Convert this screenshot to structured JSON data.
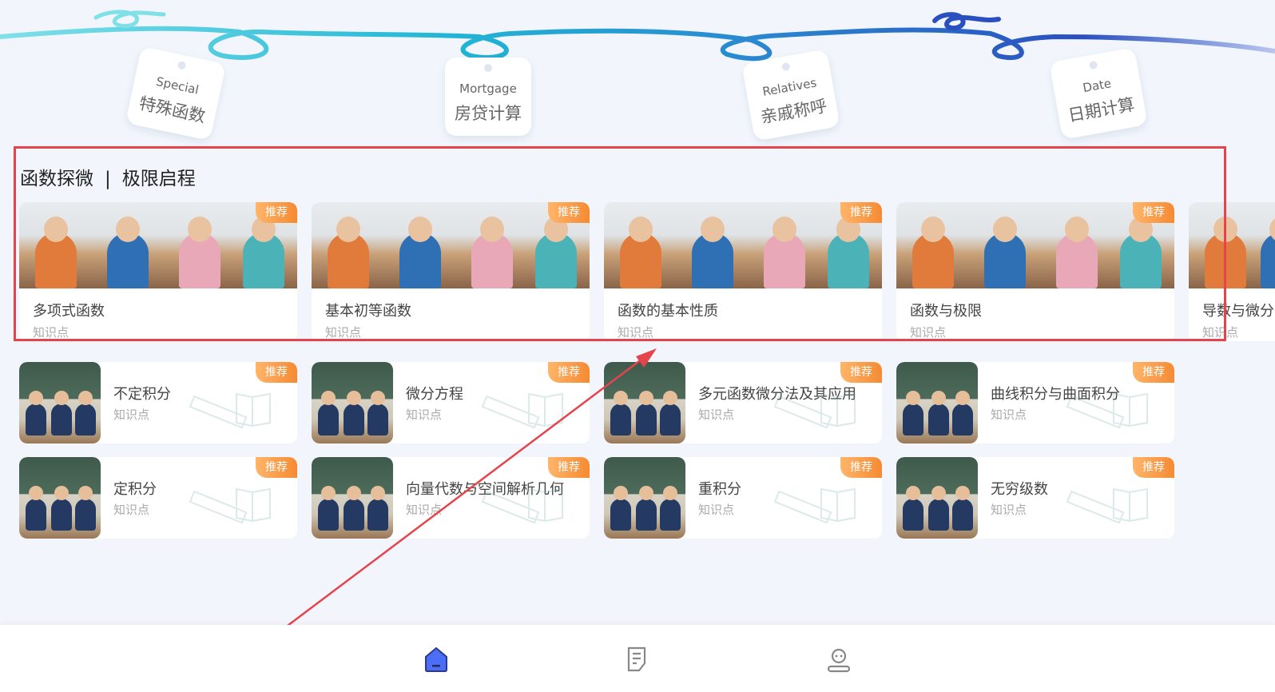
{
  "tags": [
    {
      "en": "Special",
      "zh": "特殊函数"
    },
    {
      "en": "Mortgage",
      "zh": "房贷计算"
    },
    {
      "en": "Relatives",
      "zh": "亲戚称呼"
    },
    {
      "en": "Date",
      "zh": "日期计算"
    }
  ],
  "section": {
    "left": "函数探微",
    "sep": "|",
    "right": "极限启程"
  },
  "badge": "推荐",
  "big_cards": [
    {
      "name": "多项式函数",
      "sub": "知识点"
    },
    {
      "name": "基本初等函数",
      "sub": "知识点"
    },
    {
      "name": "函数的基本性质",
      "sub": "知识点"
    },
    {
      "name": "函数与极限",
      "sub": "知识点"
    },
    {
      "name": "导数与微分",
      "sub": "知识点"
    }
  ],
  "small_cards": [
    {
      "name": "不定积分",
      "sub": "知识点"
    },
    {
      "name": "微分方程",
      "sub": "知识点"
    },
    {
      "name": "多元函数微分法及其应用",
      "sub": "知识点"
    },
    {
      "name": "曲线积分与曲面积分",
      "sub": "知识点"
    },
    {
      "name": "定积分",
      "sub": "知识点"
    },
    {
      "name": "向量代数与空间解析几何",
      "sub": "知识点"
    },
    {
      "name": "重积分",
      "sub": "知识点"
    },
    {
      "name": "无穷级数",
      "sub": "知识点"
    }
  ],
  "nav": [
    "home-icon",
    "notes-icon",
    "profile-icon"
  ],
  "colors": {
    "accent": "#4c6ef5",
    "highlight": "#e5444c",
    "badge": "#f58a33"
  }
}
